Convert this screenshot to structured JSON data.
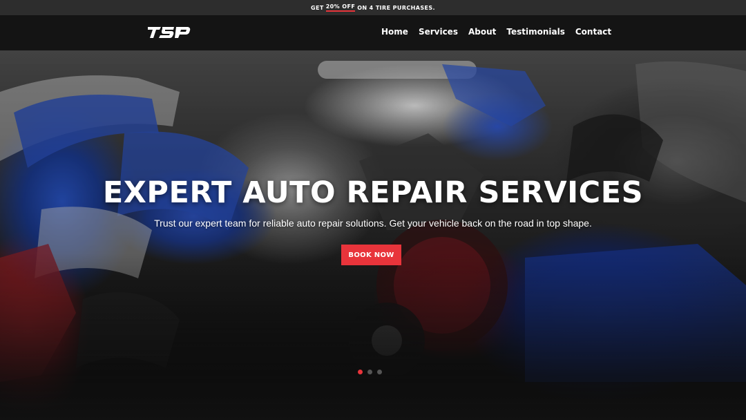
{
  "promo": {
    "prefix": "GET",
    "highlight": "20% OFF",
    "suffix": "ON 4 TIRE PURCHASES."
  },
  "header": {
    "logo_text": "TSP",
    "nav": [
      "Home",
      "Services",
      "About",
      "Testimonials",
      "Contact"
    ]
  },
  "hero": {
    "headline": "EXPERT AUTO REPAIR SERVICES",
    "subheadline": "Trust our expert team for reliable auto repair solutions. Get your vehicle back on the road in top shape.",
    "cta_label": "BOOK NOW",
    "slide_count": 3,
    "active_slide": 1
  },
  "colors": {
    "accent": "#e8343b",
    "header_bg": "#141414",
    "promo_bg": "#2d2d2d"
  }
}
